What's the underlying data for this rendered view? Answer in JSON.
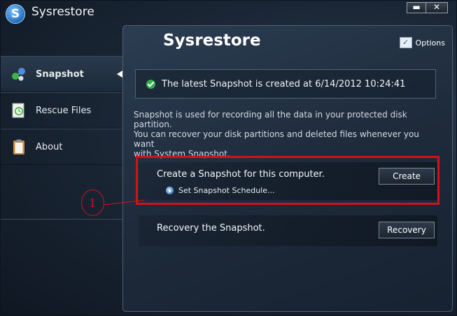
{
  "app": {
    "title": "Sysrestore",
    "logo_letter": "S",
    "window_buttons": [
      "▬",
      "✕"
    ]
  },
  "sidebar": {
    "items": [
      {
        "label": "Snapshot",
        "icon": "molecule-icon",
        "active": true
      },
      {
        "label": "Rescue Files",
        "icon": "clock-document-icon",
        "active": false
      },
      {
        "label": "About",
        "icon": "clipboard-icon",
        "active": false
      }
    ]
  },
  "panel": {
    "title": "Sysrestore",
    "options_label": "Options",
    "status_text": "The latest Snapshot is created at 6/14/2012 10:24:41",
    "description_lines": [
      "Snapshot is used for recording all the data in your protected disk partition.",
      "You can recover your disk partitions and deleted files whenever you want",
      "with System Snapshot."
    ],
    "create_row": {
      "title": "Create a Snapshot for this computer.",
      "button_label": "Create",
      "schedule_link": "Set Snapshot Schedule..."
    },
    "recovery_row": {
      "title": "Recovery the Snapshot.",
      "button_label": "Recovery"
    }
  },
  "annotation": {
    "label": "1",
    "color": "#d2111d"
  },
  "colors": {
    "background": "#1b2736",
    "highlight": "#d2111d",
    "check": "#2fb24a"
  }
}
